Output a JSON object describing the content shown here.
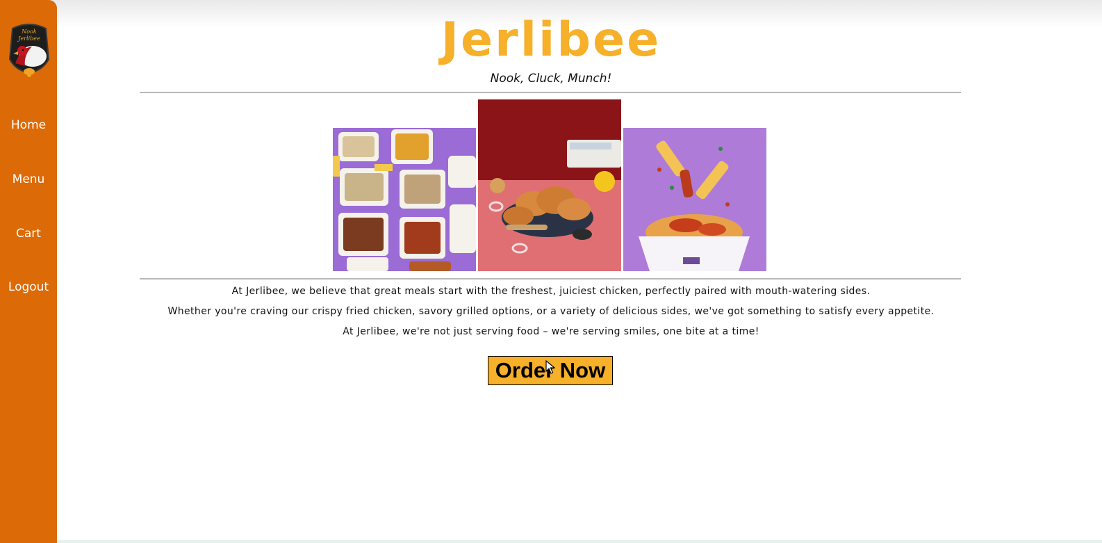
{
  "colors": {
    "sidebar": "#dc6a06",
    "brand": "#f6b02a",
    "button_bg": "#f6b02a",
    "rule": "#b8b8b8"
  },
  "logo": {
    "icon": "chicken-logo-icon",
    "text_line1": "Nook",
    "text_line2": "Jerlibee"
  },
  "nav": {
    "items": [
      {
        "label": "Home"
      },
      {
        "label": "Menu"
      },
      {
        "label": "Cart"
      },
      {
        "label": "Logout"
      }
    ]
  },
  "header": {
    "title": "Jerlibee",
    "tagline": "Nook, Cluck, Munch!"
  },
  "gallery": {
    "images": [
      {
        "icon": "food-trays-photo"
      },
      {
        "icon": "fried-chicken-photo"
      },
      {
        "icon": "loaded-fries-photo"
      }
    ]
  },
  "about": {
    "paragraphs": [
      "At Jerlibee, we believe that great meals start with the freshest, juiciest chicken, perfectly paired with mouth-watering sides.",
      "Whether you're craving our crispy fried chicken, savory grilled options, or a variety of delicious sides, we've got something to satisfy every appetite.",
      "At Jerlibee, we're not just serving food – we're serving smiles, one bite at a time!"
    ]
  },
  "cta": {
    "label": "Order Now"
  }
}
